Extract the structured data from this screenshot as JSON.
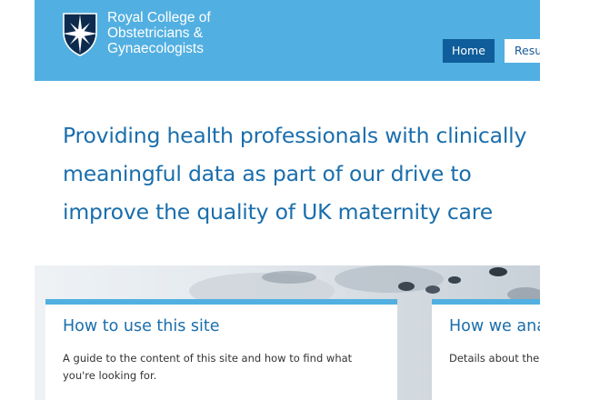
{
  "header": {
    "org_name_lines": [
      "Royal College of",
      "Obstetricians &",
      "Gynaecologists"
    ],
    "nav": [
      {
        "label": "Home",
        "active": true
      },
      {
        "label": "Results",
        "active": false
      }
    ]
  },
  "tagline": "Providing health professionals with clinically meaningful data as part of our drive to improve the quality of UK maternity care",
  "cards": [
    {
      "title": "How to use this site",
      "description": "A guide to the content of this site and how to find what you're looking for."
    },
    {
      "title": "How we analyse",
      "description": "Details about the data"
    }
  ],
  "colors": {
    "header_bg": "#52afe1",
    "nav_active_bg": "#0f5d9a",
    "heading_text": "#1a6eac",
    "card_accent": "#52afe1"
  },
  "icons": {
    "logo": "shield-star-icon"
  }
}
